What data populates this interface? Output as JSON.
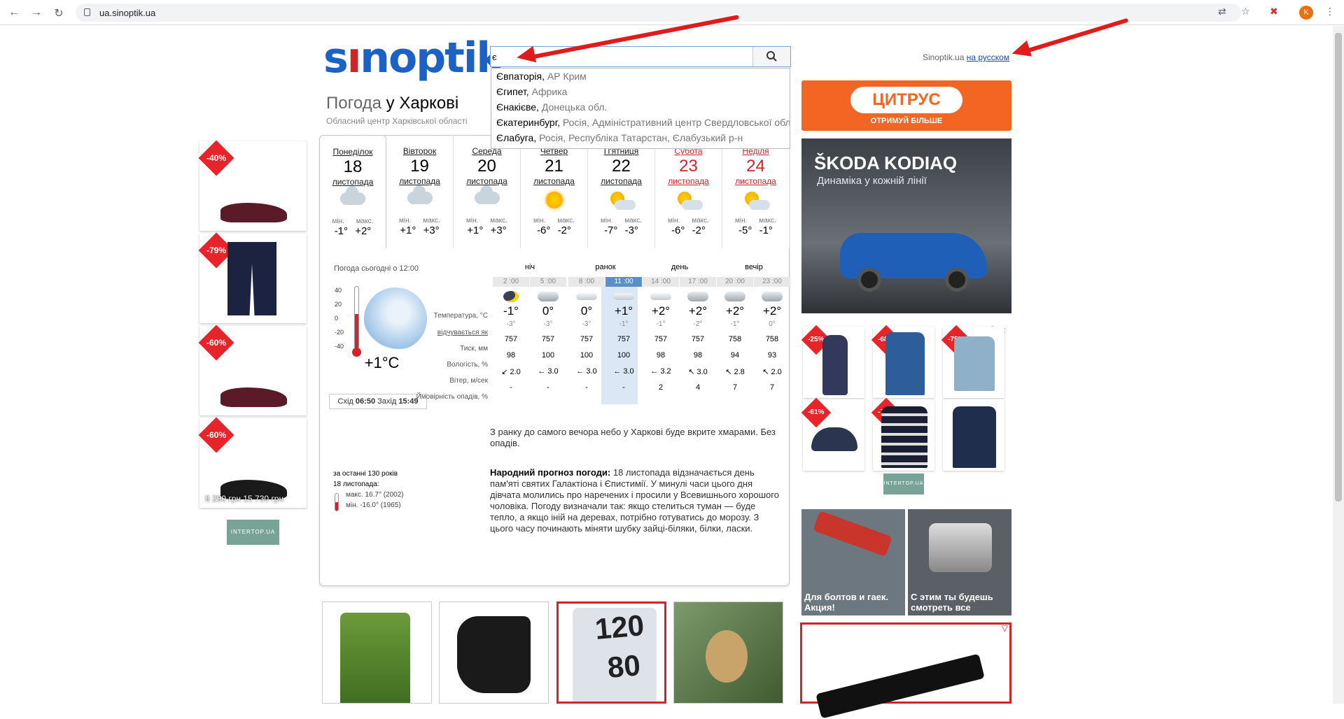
{
  "browser": {
    "url": "ua.sinoptik.ua",
    "avatar": "K"
  },
  "site": {
    "logo": "sinoptik",
    "search_value": "є",
    "lang_prefix": "Sinoptik.ua",
    "lang_link": "на русском",
    "suggestions": [
      {
        "city": "Євпаторія",
        "region": "АР Крим"
      },
      {
        "city": "Єгипет",
        "region": "Африка"
      },
      {
        "city": "Єнакієве",
        "region": "Донецька обл."
      },
      {
        "city": "Єкатеринбург",
        "region": "Росія, Адміністративний центр Свердловської обл"
      },
      {
        "city": "Єлабуга",
        "region": "Росія, Республіка Татарстан, Єлабузький р-н"
      }
    ]
  },
  "page": {
    "title_grey": "Погода",
    "title_city": "у Харкові",
    "subtitle": "Обласний центр Харківської області"
  },
  "days": [
    {
      "name": "Понеділок",
      "date": "18",
      "month": "листопада",
      "min": "-1°",
      "max": "+2°",
      "icon": "cloud-icon",
      "weekend": false
    },
    {
      "name": "Вівторок",
      "date": "19",
      "month": "листопада",
      "min": "+1°",
      "max": "+3°",
      "icon": "cloud-icon",
      "weekend": false
    },
    {
      "name": "Середа",
      "date": "20",
      "month": "листопада",
      "min": "+1°",
      "max": "+3°",
      "icon": "cloud-icon",
      "weekend": false
    },
    {
      "name": "Четвер",
      "date": "21",
      "month": "листопада",
      "min": "-6°",
      "max": "-2°",
      "icon": "sun-icon",
      "weekend": false
    },
    {
      "name": "П'ятниця",
      "date": "22",
      "month": "листопада",
      "min": "-7°",
      "max": "-3°",
      "icon": "sun-cloud-icon",
      "weekend": false
    },
    {
      "name": "Субота",
      "date": "23",
      "month": "листопада",
      "min": "-6°",
      "max": "-2°",
      "icon": "sun-cloud-icon",
      "weekend": true
    },
    {
      "name": "Неділя",
      "date": "24",
      "month": "листопада",
      "min": "-5°",
      "max": "-1°",
      "icon": "sun-cloud-icon",
      "weekend": true
    }
  ],
  "labels": {
    "min": "мін.",
    "max": "макс.",
    "now": "Погода сьогодні о 12:00",
    "temp": "Температура, °С",
    "feels": "відчувається як",
    "pressure": "Тиск, мм",
    "humidity": "Вологість, %",
    "wind": "Вітер, м/сек",
    "precip": "Ймовірність опадів, %"
  },
  "now": {
    "temp": "+1°C",
    "sunrise_label": "Схід",
    "sunrise": "06:50",
    "sunset_label": "Захід",
    "sunset": "15:49",
    "scale": [
      "40",
      "20",
      "0",
      "-20",
      "-40"
    ]
  },
  "periods": [
    "ніч",
    "ранок",
    "день",
    "вечір"
  ],
  "hourly": [
    {
      "time": "2 :00",
      "icon": "moon-icon",
      "temp": "-1°",
      "feels": "-3°",
      "pressure": "757",
      "humidity": "98",
      "wind_dir": "↙",
      "wind": "2.0",
      "precip": "-"
    },
    {
      "time": "5 :00",
      "icon": "overcast-icon",
      "temp": "0°",
      "feels": "-3°",
      "pressure": "757",
      "humidity": "100",
      "wind_dir": "←",
      "wind": "3.0",
      "precip": "-"
    },
    {
      "time": "8 :00",
      "icon": "cloud-icon",
      "temp": "0°",
      "feels": "-3°",
      "pressure": "757",
      "humidity": "100",
      "wind_dir": "←",
      "wind": "3.0",
      "precip": "-"
    },
    {
      "time": "11 :00",
      "icon": "cloud-icon",
      "temp": "+1°",
      "feels": "-1°",
      "pressure": "757",
      "humidity": "100",
      "wind_dir": "←",
      "wind": "3.0",
      "precip": "-"
    },
    {
      "time": "14 :00",
      "icon": "cloud-icon",
      "temp": "+2°",
      "feels": "-1°",
      "pressure": "757",
      "humidity": "98",
      "wind_dir": "←",
      "wind": "3.2",
      "precip": "2"
    },
    {
      "time": "17 :00",
      "icon": "overcast-icon",
      "temp": "+2°",
      "feels": "-2°",
      "pressure": "757",
      "humidity": "98",
      "wind_dir": "↖",
      "wind": "3.0",
      "precip": "4"
    },
    {
      "time": "20 :00",
      "icon": "overcast-icon",
      "temp": "+2°",
      "feels": "-1°",
      "pressure": "758",
      "humidity": "94",
      "wind_dir": "↖",
      "wind": "2.8",
      "precip": "7"
    },
    {
      "time": "23 :00",
      "icon": "overcast-icon",
      "temp": "+2°",
      "feels": "0°",
      "pressure": "758",
      "humidity": "93",
      "wind_dir": "↖",
      "wind": "2.0",
      "precip": "7"
    }
  ],
  "description": "З ранку до самого вечора небо у Харкові буде вкрите хмарами. Без опадів.",
  "folk": {
    "title": "Народний прогноз погоди:",
    "text": " 18 листопада відзначається день пам'яті святих Галактіона і Єпистимії. У минулі часи цього дня дівчата молились про наречених і просили у Всевишнього хорошого чоловіка. Погоду визначали так: якщо стелиться туман — буде тепло, а якщо іній на деревах, потрібно готуватись до морозу. З цього часу починають міняти шубку зайці-біляки, білки, ласки."
  },
  "history": {
    "line1": "за останні 130 років",
    "line2": "18 листопада:",
    "max": "макс. 16.7° (2002)",
    "min": "мін. -16.0° (1965)"
  },
  "ads": {
    "left_badges": [
      "-40%",
      "-79%",
      "-60%",
      "-60%"
    ],
    "left_price": "6 290 грн 15 730 грн",
    "intertop": "INTERTOP.UA",
    "citrus_logo": "ЦИТРУС",
    "citrus_sub": "ОТРИМУЙ БІЛЬШЕ",
    "skoda_title": "ŠKODA KODIAQ",
    "skoda_sub": "Динаміка у кожній лінії",
    "right_badges": [
      "-25%",
      "-68%",
      "-75%",
      "-61%",
      "-75%",
      ""
    ],
    "tool1": "Для болтов и гаек. Акция!",
    "tool2": "С этим ты будешь смотреть все",
    "bp_sys": "120",
    "bp_dia": "80"
  }
}
